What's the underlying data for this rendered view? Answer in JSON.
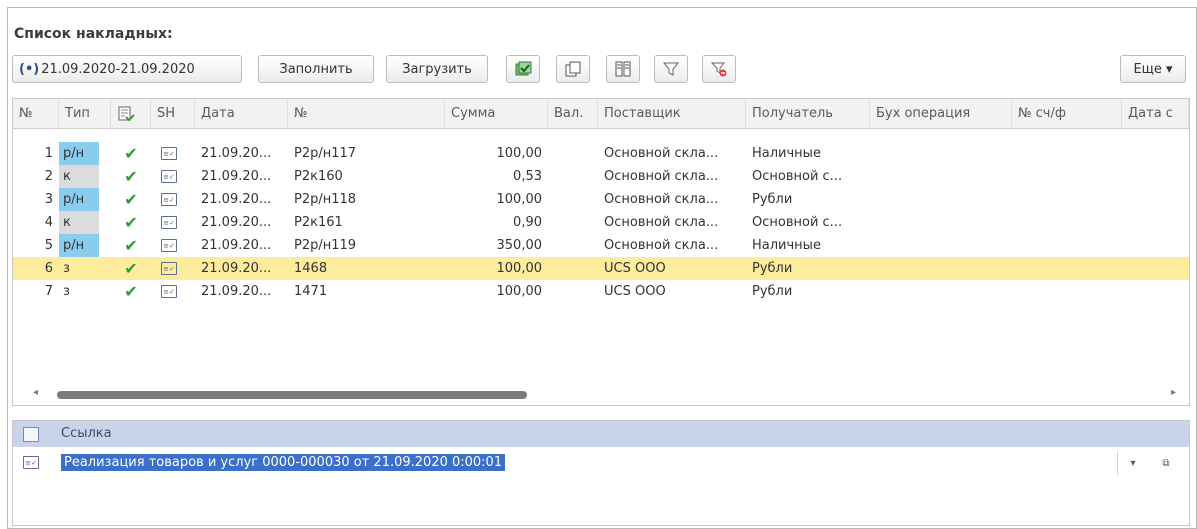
{
  "title": "Список накладных:",
  "toolbar": {
    "period_icon": "(•)",
    "period": "21.09.2020-21.09.2020",
    "fill_label": "Заполнить",
    "load_label": "Загрузить",
    "more_label": "Еще ▾"
  },
  "columns": [
    "№",
    "Тип",
    "",
    "SH",
    "Дата",
    "№",
    "Сумма",
    "Вал.",
    "Поставщик",
    "Получатель",
    "Бух операция",
    "№ сч/ф",
    "Дата с"
  ],
  "rows": [
    {
      "n": "1",
      "type": "р/н",
      "date": "21.09.20...",
      "doc": "P2р/н117",
      "sum": "100,00",
      "cur": "",
      "supplier": "Основной скла...",
      "receiver": "Наличные"
    },
    {
      "n": "2",
      "type": "к",
      "date": "21.09.20...",
      "doc": "P2к160",
      "sum": "0,53",
      "cur": "",
      "supplier": "Основной скла...",
      "receiver": "Основной с..."
    },
    {
      "n": "3",
      "type": "р/н",
      "date": "21.09.20...",
      "doc": "P2р/н118",
      "sum": "100,00",
      "cur": "",
      "supplier": "Основной скла...",
      "receiver": "Рубли"
    },
    {
      "n": "4",
      "type": "к",
      "date": "21.09.20...",
      "doc": "P2к161",
      "sum": "0,90",
      "cur": "",
      "supplier": "Основной скла...",
      "receiver": "Основной с..."
    },
    {
      "n": "5",
      "type": "р/н",
      "date": "21.09.20...",
      "doc": "P2р/н119",
      "sum": "350,00",
      "cur": "",
      "supplier": "Основной скла...",
      "receiver": "Наличные"
    },
    {
      "n": "6",
      "type": "з",
      "date": "21.09.20...",
      "doc": "1468",
      "sum": "100,00",
      "cur": "",
      "supplier": "UCS OOO",
      "receiver": "Рубли"
    },
    {
      "n": "7",
      "type": "з",
      "date": "21.09.20...",
      "doc": "1471",
      "sum": "100,00",
      "cur": "",
      "supplier": "UCS OOO",
      "receiver": "Рубли"
    }
  ],
  "ref": {
    "header": "Ссылка",
    "value": "Реализация товаров и услуг 0000-000030 от 21.09.2020 0:00:01"
  }
}
